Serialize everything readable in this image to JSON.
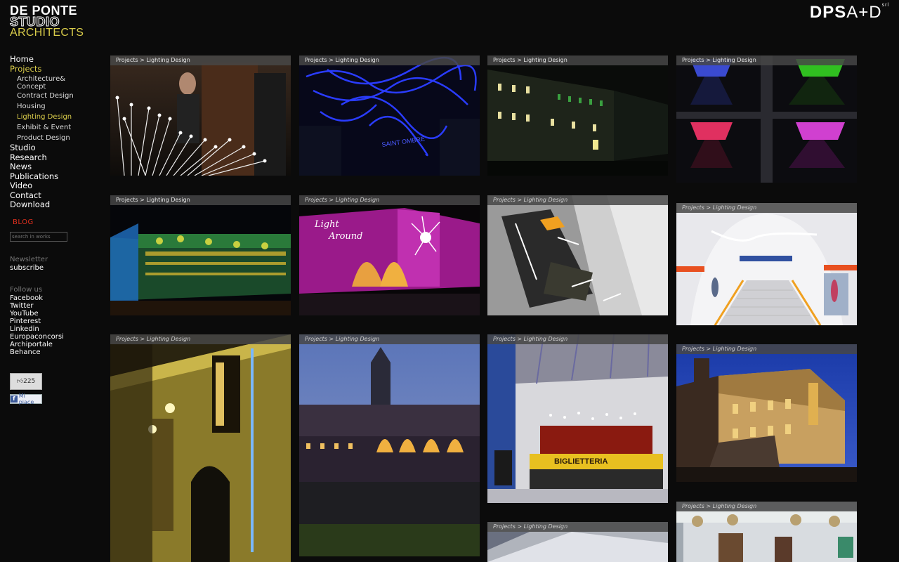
{
  "logo": {
    "line1": "DE PONTE",
    "line2": "STUDIO",
    "line3": "ARCHITECTS"
  },
  "brand": {
    "text_bold": "DPS",
    "text_thin": "A+D",
    "sup": "srl"
  },
  "nav": {
    "home": "Home",
    "projects": "Projects",
    "sub": [
      "Architecture& Concept",
      "Contract Design",
      "Housing",
      "Lighting Design",
      "Exhibit & Event",
      "Product Design"
    ],
    "active_sub": "Lighting Design",
    "after": [
      "Studio",
      "Research",
      "News",
      "Publications",
      "Video",
      "Contact",
      "Download"
    ]
  },
  "blog": "BLOG",
  "search": {
    "placeholder": "search in works"
  },
  "newsletter": {
    "label": "Newsletter",
    "link": "subscribe"
  },
  "follow": {
    "label": "Follow us",
    "links": [
      "Facebook",
      "Twitter",
      "YouTube",
      "Pinterest",
      "Linkedin",
      "Europaconcorsi",
      "Archiportale",
      "Behance"
    ]
  },
  "like": {
    "count": "225",
    "button": "Mi piace"
  },
  "crumb": "Projects > Lighting Design",
  "tiles": [
    "Tiffany lighting installation",
    "Blue neon ceiling",
    "Night building facade",
    "Colored light portals",
    "Illuminated pavilion",
    "Light Around magenta facade",
    "Staircase lighting render",
    "Metro station render",
    "Yellow lit facade",
    "Courtyard arcade at dusk",
    "Biglietteria interior",
    "Castle at night",
    "Ceiling detail",
    "Ornate interior"
  ]
}
